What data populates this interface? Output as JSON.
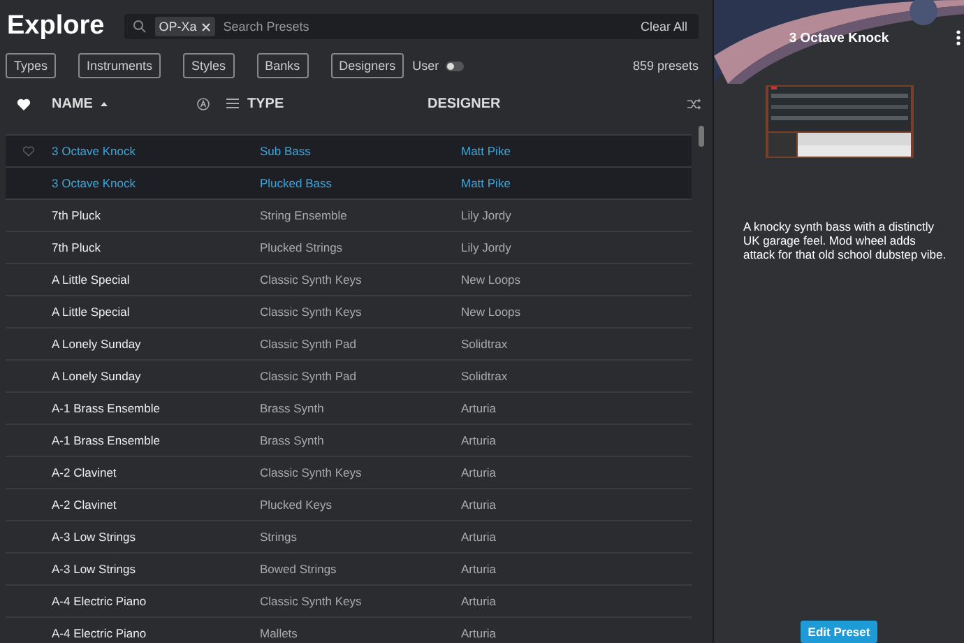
{
  "header": {
    "title": "Explore",
    "search": {
      "tag": "OP-Xa",
      "placeholder": "Search Presets",
      "clear": "Clear All"
    }
  },
  "filters": [
    "Types",
    "Instruments",
    "Styles",
    "Banks",
    "Designers"
  ],
  "user_toggle": {
    "label": "User",
    "on": false
  },
  "count": "859 presets",
  "table": {
    "columns": [
      {
        "label": "NAME",
        "kind": "sort"
      },
      {
        "label": "TYPE",
        "kind": "menu"
      },
      {
        "label": "DESIGNER",
        "kind": "shuffle"
      }
    ],
    "rows": [
      {
        "name": "3 Octave Knock",
        "type": "Sub Bass",
        "designer": "Matt Pike",
        "selected": true,
        "hovered": true
      },
      {
        "name": "3 Octave Knock",
        "type": "Plucked Bass",
        "designer": "Matt Pike",
        "selected": true,
        "hovered": false
      },
      {
        "name": "7th Pluck",
        "type": "String Ensemble",
        "designer": "Lily Jordy",
        "selected": false,
        "hovered": false
      },
      {
        "name": "7th Pluck",
        "type": "Plucked Strings",
        "designer": "Lily Jordy",
        "selected": false,
        "hovered": false
      },
      {
        "name": "A Little Special",
        "type": "Classic Synth Keys",
        "designer": "New Loops",
        "selected": false,
        "hovered": false
      },
      {
        "name": "A Little Special",
        "type": "Classic Synth Keys",
        "designer": "New Loops",
        "selected": false,
        "hovered": false
      },
      {
        "name": "A Lonely Sunday",
        "type": "Classic Synth Pad",
        "designer": "Solidtrax",
        "selected": false,
        "hovered": false
      },
      {
        "name": "A Lonely Sunday",
        "type": "Classic Synth Pad",
        "designer": "Solidtrax",
        "selected": false,
        "hovered": false
      },
      {
        "name": "A-1 Brass Ensemble",
        "type": "Brass Synth",
        "designer": "Arturia",
        "selected": false,
        "hovered": false
      },
      {
        "name": "A-1 Brass Ensemble",
        "type": "Brass Synth",
        "designer": "Arturia",
        "selected": false,
        "hovered": false
      },
      {
        "name": "A-2 Clavinet",
        "type": "Classic Synth Keys",
        "designer": "Arturia",
        "selected": false,
        "hovered": false
      },
      {
        "name": "A-2 Clavinet",
        "type": "Plucked Keys",
        "designer": "Arturia",
        "selected": false,
        "hovered": false
      },
      {
        "name": "A-3 Low Strings",
        "type": "Strings",
        "designer": "Arturia",
        "selected": false,
        "hovered": false
      },
      {
        "name": "A-3 Low Strings",
        "type": "Bowed Strings",
        "designer": "Arturia",
        "selected": false,
        "hovered": false
      },
      {
        "name": "A-4 Electric Piano",
        "type": "Classic Synth Keys",
        "designer": "Arturia",
        "selected": false,
        "hovered": false
      },
      {
        "name": "A-4 Electric Piano",
        "type": "Mallets",
        "designer": "Arturia",
        "selected": false,
        "hovered": false
      }
    ]
  },
  "preset_panel": {
    "title": "3 Octave Knock",
    "description": "A knocky synth bass with a distinctly UK garage feel. Mod wheel adds attack for that old school dubstep vibe.",
    "button": "Edit Preset"
  }
}
